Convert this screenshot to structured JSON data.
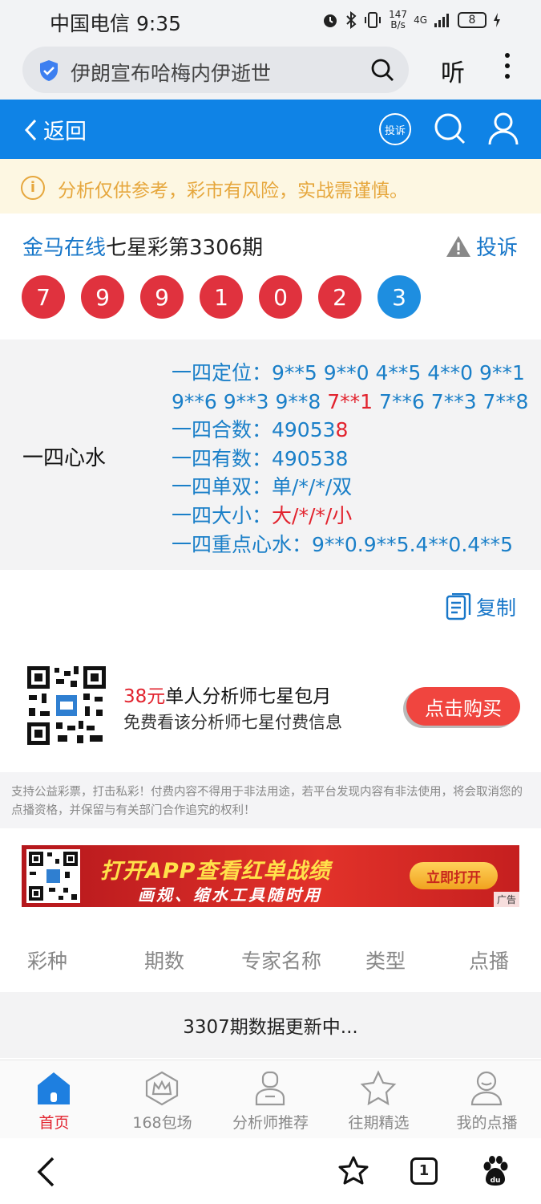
{
  "status_bar": {
    "carrier_time": "中国电信 9:35",
    "net_speed_value": "147",
    "net_speed_unit": "B/s",
    "signal": "4G",
    "battery": "8"
  },
  "browser": {
    "search_query": "伊朗宣布哈梅内伊逝世",
    "listen_label": "听"
  },
  "header": {
    "back_label": "返回",
    "complain_icon_label": "投诉"
  },
  "warning": {
    "icon": "i",
    "text": "分析仅供参考，彩市有风险，实战需谨慎。"
  },
  "issue": {
    "brand": "金马在线",
    "title": "七星彩第3306期",
    "complain_label": "投诉",
    "numbers": [
      "7",
      "9",
      "9",
      "1",
      "0",
      "2",
      "3"
    ]
  },
  "analysis": {
    "label": "一四心水",
    "line1": "一四定位：9**5 9**0 4**5 4**0 9**1",
    "line2_a": "9**6 9**3 9**8 ",
    "line2_red": "7**1",
    "line2_b": " 7**6 7**3 7**8",
    "line3_a": "一四合数：49053",
    "line3_red": "8",
    "line4": "一四有数：490538",
    "line5": "一四单双：单/*/*/双",
    "line6_a": "一四大小：",
    "line6_red": "大/*/*/小",
    "line7": "一四重点心水：9**0.9**5.4**0.4**5"
  },
  "copy_label": "复制",
  "promo": {
    "price": "38元",
    "title": "单人分析师七星包月",
    "subtitle": "免费看该分析师七星付费信息",
    "button": "点击购买"
  },
  "disclaimer": "支持公益彩票，打击私彩！付费内容不得用于非法用途，若平台发现内容有非法使用，将会取消您的点播资格，并保留与有关部门合作追究的权利！",
  "banner": {
    "line1": "打开APP查看红单战绩",
    "line2": "画规、缩水工具随时用",
    "button": "立即打开",
    "ad_tag": "广告"
  },
  "table": {
    "headers": [
      "彩种",
      "期数",
      "专家名称",
      "类型",
      "点播"
    ],
    "status_row": "3307期数据更新中..."
  },
  "tabbar": {
    "items": [
      {
        "label": "首页",
        "icon": "home-icon",
        "active": true
      },
      {
        "label": "168包场",
        "icon": "crown-icon",
        "active": false
      },
      {
        "label": "分析师推荐",
        "icon": "analyst-icon",
        "active": false
      },
      {
        "label": "往期精选",
        "icon": "star-icon",
        "active": false
      },
      {
        "label": "我的点播",
        "icon": "user-icon",
        "active": false
      }
    ]
  },
  "system_nav": {
    "tab_count": "1"
  },
  "colors": {
    "header_blue": "#0f83e6",
    "ball_red": "#e0323e",
    "ball_blue": "#1e8ee0",
    "text_blue": "#1a7fc8",
    "accent_red": "#e2232e",
    "warning_orange": "#e6a73d"
  }
}
